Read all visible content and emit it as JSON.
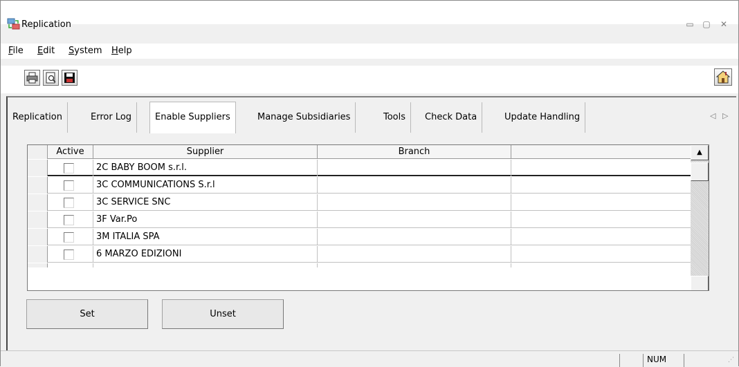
{
  "window": {
    "title": "Replication",
    "controls": {
      "minimize": "▭",
      "restore": "▢",
      "close": "✕"
    }
  },
  "menu": {
    "items": [
      {
        "label": "File",
        "key": "F",
        "rest": "ile"
      },
      {
        "label": "Edit",
        "key": "E",
        "rest": "dit"
      },
      {
        "label": "System",
        "key": "S",
        "rest": "ystem"
      },
      {
        "label": "Help",
        "key": "H",
        "rest": "elp"
      }
    ]
  },
  "toolbar": {
    "buttons": [
      "printer-icon",
      "print-preview-icon",
      "save-icon"
    ],
    "home": "home-icon"
  },
  "tabs": {
    "items": [
      "Replication",
      "Error Log",
      "Enable Suppliers",
      "Manage Subsidiaries",
      "Tools",
      "Check Data",
      "Update Handling"
    ],
    "active": "Enable Suppliers"
  },
  "grid": {
    "columns": [
      "Active",
      "Supplier",
      "Branch",
      ""
    ],
    "rows": [
      {
        "active": false,
        "supplier": "2C BABY BOOM s.r.l.",
        "branch": ""
      },
      {
        "active": false,
        "supplier": "3C COMMUNICATIONS S.r.l",
        "branch": ""
      },
      {
        "active": false,
        "supplier": "3C SERVICE SNC",
        "branch": ""
      },
      {
        "active": false,
        "supplier": "3F  Var.Po",
        "branch": ""
      },
      {
        "active": false,
        "supplier": "3M ITALIA SPA",
        "branch": ""
      },
      {
        "active": false,
        "supplier": "6 MARZO EDIZIONI",
        "branch": ""
      }
    ]
  },
  "buttons": {
    "set": "Set",
    "unset": "Unset"
  },
  "status": {
    "num": "NUM"
  }
}
